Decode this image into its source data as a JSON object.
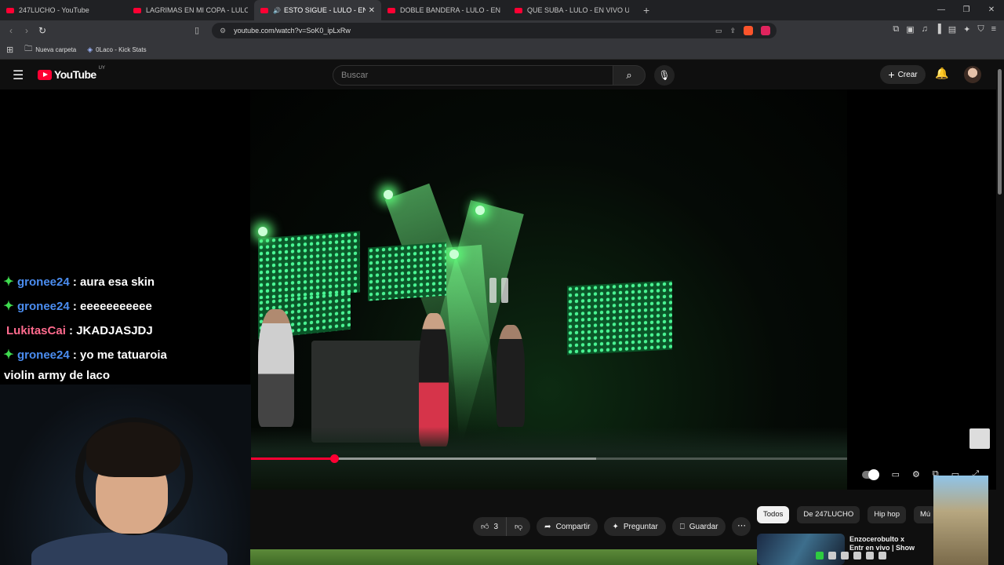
{
  "browser": {
    "tabs": [
      {
        "label": "247LUCHO - YouTube",
        "active": false,
        "audio": false
      },
      {
        "label": "LAGRIMAS EN MI COPA - LULO - EN",
        "active": false,
        "audio": false
      },
      {
        "label": "ESTO SIGUE - LULO - EN VIVO",
        "active": true,
        "audio": true
      },
      {
        "label": "DOBLE BANDERA - LULO - EN VIVO",
        "active": false,
        "audio": false
      },
      {
        "label": "QUE SUBA - LULO - EN VIVO UNICLUB",
        "active": false,
        "audio": false
      }
    ],
    "url": "youtube.com/watch?v=SoK0_ipLxRw",
    "bookmarks": [
      {
        "label": "Nueva carpeta",
        "icon": "folder-icon"
      },
      {
        "label": "0Laco - Kick Stats",
        "icon": "kick-icon"
      }
    ],
    "brave_colors": {
      "shield": "#fb542b",
      "rewards": "#e0245e"
    }
  },
  "youtube": {
    "logo_text": "YouTube",
    "country_code": "UY",
    "search_placeholder": "Buscar",
    "create_label": "Crear"
  },
  "player": {
    "state": "paused",
    "progress_fraction": 0.14,
    "buffered_fraction": 0.58,
    "accent": "#ff0033"
  },
  "stream_chat": [
    {
      "user": "gronee24",
      "message": ": aura esa skin",
      "badge": true,
      "user_color": "#4b8df0"
    },
    {
      "user": "gronee24",
      "message": ": eeeeeeeeeee",
      "badge": true,
      "user_color": "#4b8df0"
    },
    {
      "user": "LukitasCai",
      "message": ": JKADJASJDJ",
      "badge": false,
      "user_color": "#ff6b8e"
    },
    {
      "user": "gronee24",
      "message": ": yo me tatuaroia",
      "badge": true,
      "user_color": "#4b8df0"
    }
  ],
  "stream_chat_continuation": "violin army de laco",
  "actions": {
    "like_count": "3",
    "share_label": "Compartir",
    "ask_label": "Preguntar",
    "save_label": "Guardar"
  },
  "chips": [
    "Todos",
    "De 247LUCHO",
    "Hip hop",
    "Mú"
  ],
  "recommended": {
    "title": "Enzocerobulto x Entr en vivo | Show comp"
  }
}
